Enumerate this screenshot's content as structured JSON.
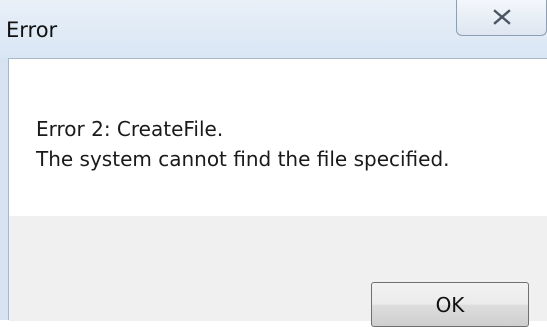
{
  "window": {
    "title": "Error"
  },
  "message": {
    "line1": "Error 2: CreateFile.",
    "line2": "The system cannot find the file specified."
  },
  "buttons": {
    "ok_label": "OK"
  },
  "icons": {
    "close": "close-x-icon"
  },
  "colors": {
    "title_bar": "#dce8f5",
    "button_area": "#f0f0f0",
    "message_background": "#ffffff"
  }
}
